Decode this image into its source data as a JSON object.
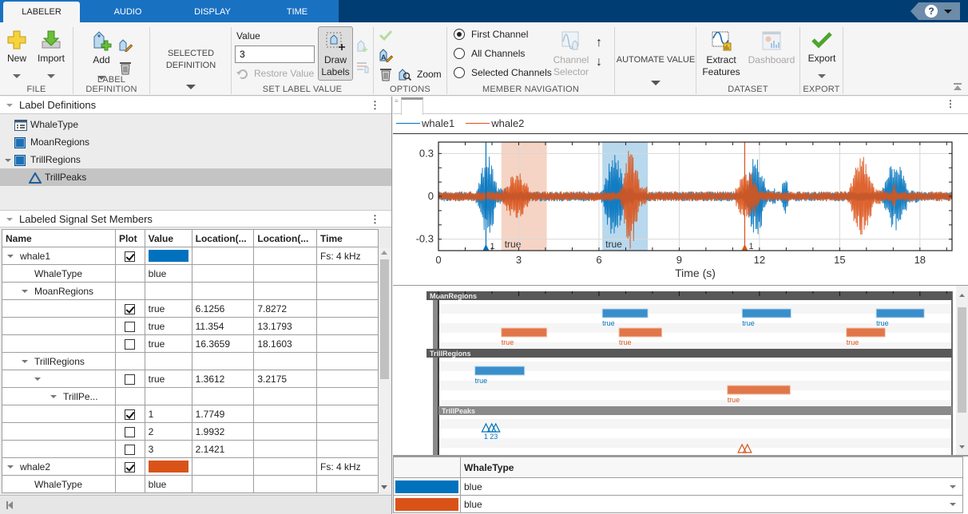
{
  "tabs": [
    {
      "label": "LABELER",
      "active": true
    },
    {
      "label": "AUDIO",
      "active": false
    },
    {
      "label": "DISPLAY",
      "active": false
    },
    {
      "label": "TIME",
      "active": false
    }
  ],
  "help": {
    "icon": "help-icon",
    "label": "?"
  },
  "ribbon": {
    "file": {
      "label": "FILE",
      "new": "New",
      "import": "Import"
    },
    "label_definition": {
      "label": "LABEL DEFINITION",
      "add": "Add"
    },
    "selected_definition": {
      "line1": "SELECTED",
      "line2": "DEFINITION"
    },
    "set_label_value": {
      "label": "SET LABEL VALUE",
      "value_label": "Value",
      "value": "3",
      "restore": "Restore Value",
      "draw1": "Draw",
      "draw2": "Labels"
    },
    "options": {
      "label": "OPTIONS",
      "zoom": "Zoom"
    },
    "member_navigation": {
      "label": "MEMBER NAVIGATION",
      "radios": [
        {
          "label": "First Channel",
          "checked": true
        },
        {
          "label": "All Channels",
          "checked": false
        },
        {
          "label": "Selected Channels",
          "checked": false
        }
      ],
      "channel1": "Channel",
      "channel2": "Selector"
    },
    "automate": {
      "label": "AUTOMATE VALUE"
    },
    "dataset": {
      "label": "DATASET",
      "extract1": "Extract",
      "extract2": "Features",
      "dashboard": "Dashboard"
    },
    "export": {
      "label": "EXPORT",
      "export": "Export"
    }
  },
  "label_definitions": {
    "title": "Label Definitions",
    "items": [
      {
        "name": "WhaleType",
        "icon": "attribute-icon"
      },
      {
        "name": "MoanRegions",
        "icon": "roi-icon"
      },
      {
        "name": "TrillRegions",
        "icon": "roi-icon"
      },
      {
        "name": "TrillPeaks",
        "icon": "point-icon",
        "selected": true
      }
    ]
  },
  "members": {
    "title": "Labeled Signal Set Members",
    "columns": [
      "Name",
      "Plot",
      "Value",
      "Location(...",
      "Location(...",
      "Time"
    ],
    "rows": [
      {
        "name": "whale1",
        "level": 0,
        "expand": true,
        "plot": true,
        "swatch": "#0072bd",
        "loc1": "",
        "loc2": "",
        "time": "Fs: 4 kHz"
      },
      {
        "name": "WhaleType",
        "level": 1,
        "value": "blue"
      },
      {
        "name": "MoanRegions",
        "level": 1,
        "expand": true
      },
      {
        "name": "",
        "level": 2,
        "plot": true,
        "value": "true",
        "loc1": "6.1256",
        "loc2": "7.8272"
      },
      {
        "name": "",
        "level": 2,
        "plot": false,
        "value": "true",
        "loc1": "11.354",
        "loc2": "13.1793"
      },
      {
        "name": "",
        "level": 2,
        "plot": false,
        "value": "true",
        "loc1": "16.3659",
        "loc2": "18.1603"
      },
      {
        "name": "TrillRegions",
        "level": 1,
        "expand": true
      },
      {
        "name": "",
        "level": 2,
        "expand": true,
        "plot": false,
        "value": "true",
        "loc1": "1.3612",
        "loc2": "3.2175"
      },
      {
        "name": "TrillPe...",
        "level": 3,
        "expand": true
      },
      {
        "name": "",
        "level": 4,
        "plot": true,
        "value": "1",
        "loc1": "1.7749"
      },
      {
        "name": "",
        "level": 4,
        "plot": false,
        "value": "2",
        "loc1": "1.9932"
      },
      {
        "name": "",
        "level": 4,
        "plot": false,
        "value": "3",
        "loc1": "2.1421"
      },
      {
        "name": "whale2",
        "level": 0,
        "expand": true,
        "plot": true,
        "swatch": "#d95319",
        "time": "Fs: 4 kHz"
      },
      {
        "name": "WhaleType",
        "level": 1,
        "value": "blue"
      }
    ]
  },
  "legend": [
    {
      "name": "whale1",
      "color": "#0072bd"
    },
    {
      "name": "whale2",
      "color": "#d95319"
    }
  ],
  "chart_data": {
    "type": "line",
    "xlabel": "Time (s)",
    "ylabel": "",
    "xlim": [
      0,
      19.2
    ],
    "ylim": [
      -0.38,
      0.38
    ],
    "xticks": [
      0,
      3,
      6,
      9,
      12,
      15,
      18
    ],
    "yticks": [
      -0.3,
      0,
      0.3
    ],
    "ytick_labels": [
      "-0.3",
      "0",
      "0.3"
    ],
    "grid": true,
    "series": [
      {
        "name": "whale1",
        "color": "#0072bd",
        "bursts": [
          [
            1.4,
            2.5,
            0.3
          ],
          [
            6.1,
            7.3,
            0.3
          ],
          [
            11.4,
            12.6,
            0.28
          ],
          [
            12.8,
            13.2,
            0.15
          ],
          [
            16.5,
            18.0,
            0.24
          ]
        ]
      },
      {
        "name": "whale2",
        "color": "#d95319",
        "bursts": [
          [
            2.3,
            3.9,
            0.17
          ],
          [
            6.8,
            7.8,
            0.37
          ],
          [
            11.0,
            12.4,
            0.19
          ],
          [
            15.3,
            16.7,
            0.28
          ],
          [
            16.9,
            17.2,
            0.1
          ]
        ]
      }
    ],
    "regions": [
      {
        "x0": 2.35,
        "x1": 4.05,
        "color": "#d95319",
        "label": "true"
      },
      {
        "x0": 6.1256,
        "x1": 7.8272,
        "color": "#0072bd",
        "label": "true"
      }
    ],
    "points": [
      {
        "x": 1.7749,
        "color": "#0072bd",
        "label": "1"
      },
      {
        "x": 11.45,
        "color": "#d95319",
        "label": "1"
      }
    ]
  },
  "timeline": {
    "sections": [
      {
        "name": "MoanRegions",
        "bars": [
          {
            "x0": 6.1256,
            "x1": 7.8272,
            "color": "#0072bd",
            "label": "true",
            "row": 0
          },
          {
            "x0": 11.354,
            "x1": 13.1793,
            "color": "#0072bd",
            "label": "true",
            "row": 0
          },
          {
            "x0": 16.3659,
            "x1": 18.1603,
            "color": "#0072bd",
            "label": "true",
            "row": 0
          },
          {
            "x0": 2.35,
            "x1": 4.05,
            "color": "#d95319",
            "label": "true",
            "row": 1
          },
          {
            "x0": 6.75,
            "x1": 8.35,
            "color": "#d95319",
            "label": "true",
            "row": 1
          },
          {
            "x0": 15.25,
            "x1": 16.7,
            "color": "#d95319",
            "label": "true",
            "row": 1
          }
        ]
      },
      {
        "name": "TrillRegions",
        "bars": [
          {
            "x0": 1.3612,
            "x1": 3.2175,
            "color": "#0072bd",
            "label": "true",
            "row": 0
          },
          {
            "x0": 10.8,
            "x1": 13.15,
            "color": "#d95319",
            "label": "true",
            "row": 1
          }
        ]
      },
      {
        "name": "TrillPeaks",
        "points": [
          {
            "x": 1.7749,
            "color": "#0072bd",
            "label": "1"
          },
          {
            "x": 1.9932,
            "color": "#0072bd",
            "label": "2"
          },
          {
            "x": 2.1421,
            "color": "#0072bd",
            "label": "3"
          },
          {
            "x": 11.35,
            "color": "#d95319",
            "label": ""
          },
          {
            "x": 11.55,
            "color": "#d95319",
            "label": ""
          }
        ]
      }
    ]
  },
  "whaletype_table": {
    "header": "WhaleType",
    "rows": [
      {
        "swatch": "#0072bd",
        "value": "blue"
      },
      {
        "swatch": "#d95319",
        "value": "blue"
      }
    ]
  }
}
